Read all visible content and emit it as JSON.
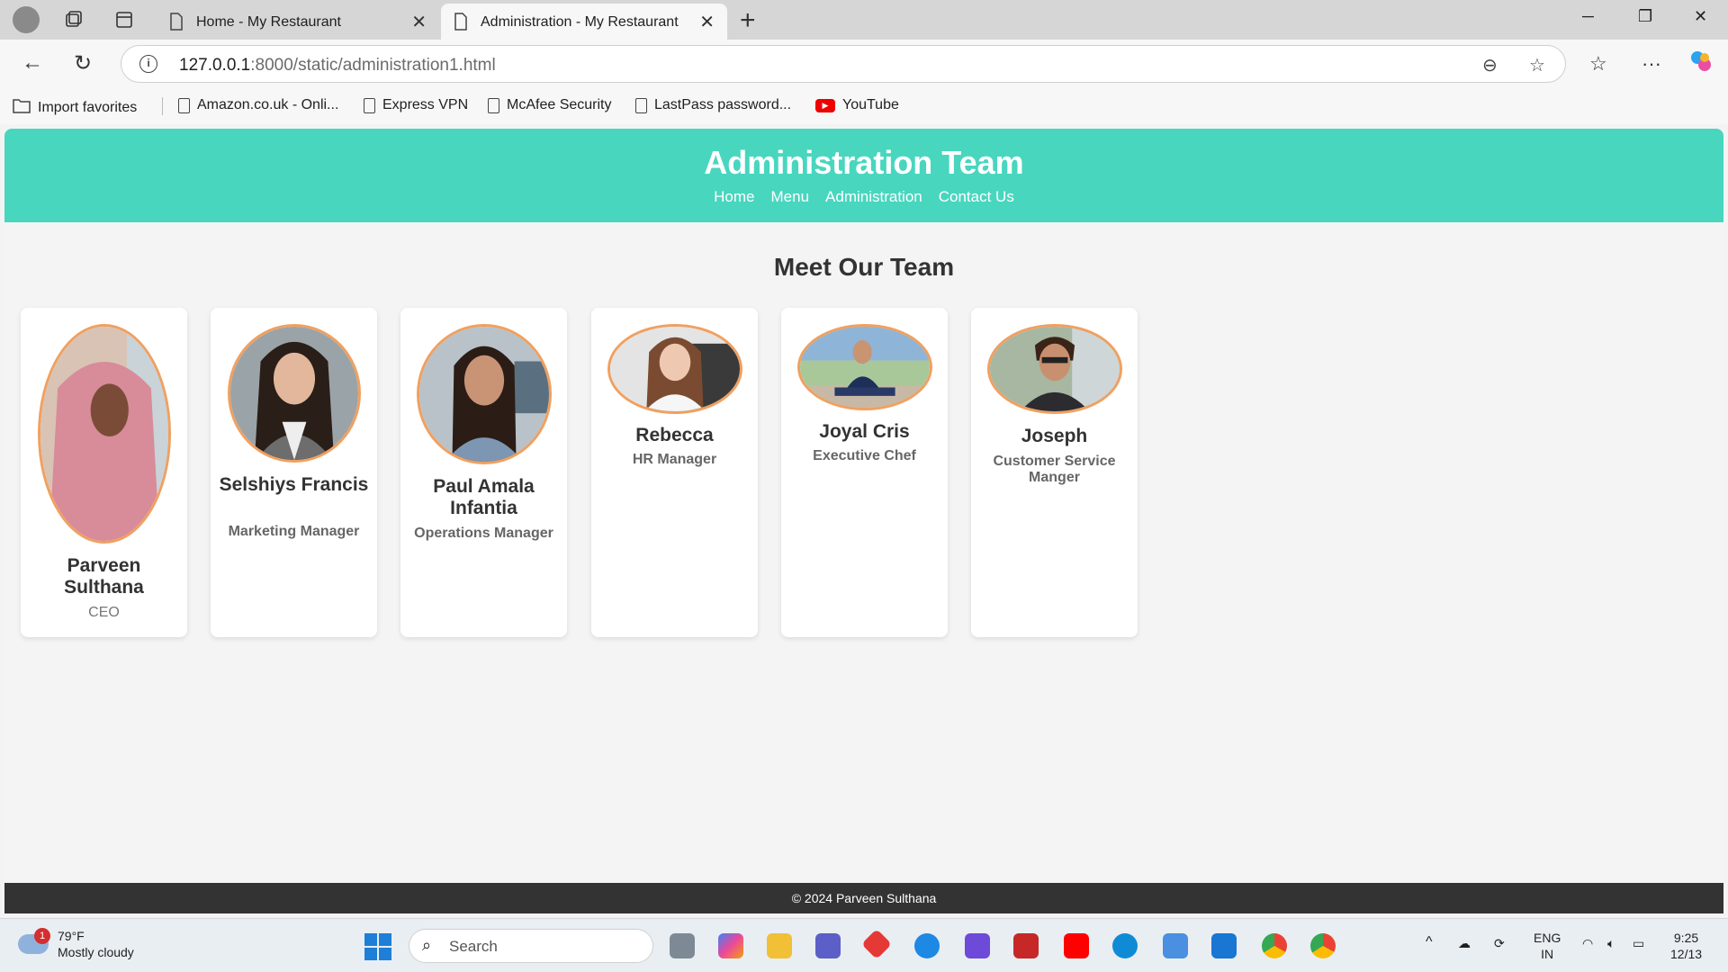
{
  "browser": {
    "tabs": [
      {
        "title": "Home - My Restaurant",
        "active": false
      },
      {
        "title": "Administration - My Restaurant",
        "active": true
      }
    ],
    "url_host": "127.0.0.1",
    "url_rest": ":8000/static/administration1.html",
    "bookmarks": [
      {
        "label": "Import favorites"
      },
      {
        "label": "Amazon.co.uk - Onli..."
      },
      {
        "label": "Express VPN"
      },
      {
        "label": "McAfee Security"
      },
      {
        "label": "LastPass password..."
      },
      {
        "label": "YouTube"
      }
    ]
  },
  "site": {
    "title": "Administration Team",
    "nav": [
      "Home",
      "Menu",
      "Administration",
      "Contact Us"
    ],
    "section_title": "Meet Our Team",
    "team": [
      {
        "name": "Parveen Sulthana",
        "role": "CEO"
      },
      {
        "name": "Selshiys Francis",
        "role": "Marketing Manager"
      },
      {
        "name": "Paul Amala Infantia",
        "role": "Operations Manager"
      },
      {
        "name": "Rebecca",
        "role": "HR Manager"
      },
      {
        "name": "Joyal Cris",
        "role": "Executive Chef"
      },
      {
        "name": "Joseph",
        "role": "Customer Service Manger"
      }
    ],
    "footer": "© 2024 Parveen Sulthana"
  },
  "taskbar": {
    "weather_badge": "1",
    "temperature": "79°F",
    "condition": "Mostly cloudy",
    "search_placeholder": "Search",
    "language_line1": "ENG",
    "language_line2": "IN",
    "time": "9:25",
    "date": "12/13"
  },
  "colors": {
    "header_bg": "#48d6bf",
    "photo_border": "#f0a060",
    "footer_bg": "#333333"
  }
}
